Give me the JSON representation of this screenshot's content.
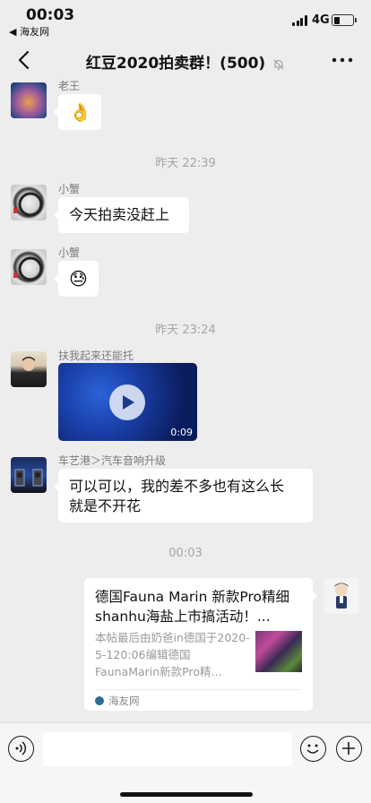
{
  "status_bar": {
    "time": "00:03",
    "back_app": "◀ 海友网",
    "network": "4G",
    "battery_level": 0.25
  },
  "nav": {
    "title": "红豆2020拍卖群！(500)",
    "back_icon": "chevron-left-icon",
    "mute_icon": "bell-off-icon",
    "more_icon": "more-dots-icon"
  },
  "messages": [
    {
      "sender": "老王",
      "content": "👌",
      "type": "emoji"
    },
    {
      "type": "timestamp",
      "text": "昨天 22:39"
    },
    {
      "sender": "小蟹",
      "content": "今天拍卖没赶上",
      "type": "text"
    },
    {
      "sender": "小蟹",
      "content": "😓",
      "type": "emoji"
    },
    {
      "type": "timestamp",
      "text": "昨天 23:24"
    },
    {
      "sender": "扶我起来还能托",
      "type": "video",
      "duration": "0:09"
    },
    {
      "sender": "车艺港＞汽车音响升级",
      "content_line1": "可以可以，我的差不多也有这么长",
      "content_line2": "就是不开花",
      "type": "text"
    },
    {
      "type": "timestamp",
      "text": "00:03"
    },
    {
      "type": "link",
      "title": "德国Fauna Marin 新款Pro精细shanhu海盐上市搞活动！...",
      "description": "本帖最后由奶爸in德国于2020-5-120:06编辑德国FaunaMarin新款Pro精...",
      "source": "海友网"
    }
  ],
  "input": {
    "placeholder": ""
  },
  "colors": {
    "background": "#ededed",
    "bubble": "#ffffff",
    "timestamp": "#a5a5a5",
    "sender_name": "#7a7a7a"
  }
}
